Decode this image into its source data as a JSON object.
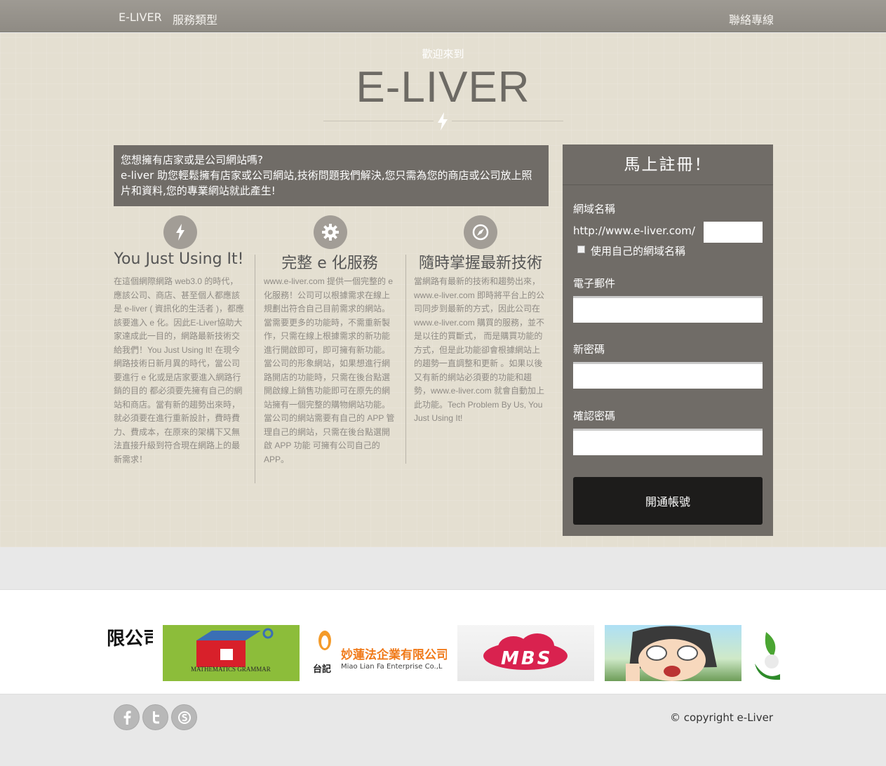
{
  "nav": {
    "brand": "E-LIVER",
    "services": "服務類型",
    "contact": "聯絡專線"
  },
  "hero": {
    "welcome": "歡迎來到",
    "title": "E-LIVER",
    "intro_line1": "您想擁有店家或是公司網站嗎?",
    "intro_line2": "e-liver 助您輕鬆擁有店家或公司網站,技術問題我們解決,您只需為您的商店或公司放上照片和資料,您的專業網站就此產生!"
  },
  "features": [
    {
      "icon": "bolt-icon",
      "title": "You Just Using It!",
      "text": "在這個網際網路 web3.0 的時代，應該公司、商店、甚至個人都應該是 e-liver ( 資訊化的生活者 )，都應該要進入 e 化。因此E-Liver協助大家達成此一目的，網路最新技術交給我們！You Just Using It! 在現今網路技術日新月異的時代，當公司要進行 e 化或是店家要進入網路行銷的目的 都必須要先擁有自己的網站和商店。當有新的趨勢出來時，就必須要在進行重新設計，費時費力、費成本，在原來的架構下又無法直接升級到符合現在網路上的最新需求！"
    },
    {
      "icon": "gear-icon",
      "title": "完整 e 化服務",
      "text": "www.e-liver.com 提供一個完整的 e 化服務！公司可以根據需求在線上規劃出符合自己目前需求的網站。當需要更多的功能時，不需重新製作，只需在線上根據需求的新功能進行開啟即可，即可擁有新功能。當公司的形象網站，如果想進行網路開店的功能時，只需在後台點選開啟線上銷售功能即可在原先的網站擁有一個完整的購物網站功能。當公司的網站需要有自己的 APP 管理自己的網站，只需在後台點選開啟 APP 功能 可擁有公司自己的 APP。"
    },
    {
      "icon": "compass-icon",
      "title": "隨時掌握最新技術",
      "text": "當網路有最新的技術和趨勢出來，www.e-liver.com 即時將平台上的公司同步到最新的方式，因此公司在 www.e-liver.com 購買的服務，並不是以往的買斷式， 而是購買功能的方式，但是此功能卻會根據網站上的趨勢一直調整和更新 。如果以後又有新的網站必須要的功能和趨勢，www.e-liver.com 就會自動加上此功能。Tech Problem By Us, You Just Using It!"
    }
  ],
  "register": {
    "title": "馬上註冊！",
    "domain_label": "網域名稱",
    "domain_prefix": "http://www.e-liver.com/",
    "own_domain_label": "使用自己的網域名稱",
    "email_label": "電子郵件",
    "password_label": "新密碼",
    "confirm_label": "確認密碼",
    "submit": "開通帳號"
  },
  "logos": [
    {
      "name": "company-logo-partial",
      "text": "限公司"
    },
    {
      "name": "mathematics-grammar-logo",
      "text": "MATHEMATICS GRAMMAR"
    },
    {
      "name": "miao-lian-fa-logo",
      "text_cn": "妙蓮法企業有限公司",
      "text_en": "Miao Lian Fa Enterprise Co.,L",
      "brand": "台記"
    },
    {
      "name": "mbs-logo",
      "text": "MBS"
    },
    {
      "name": "anime-character-image"
    },
    {
      "name": "green-leaf-logo"
    }
  ],
  "footer": {
    "copyright": "© copyright e-Liver"
  },
  "colors": {
    "panel": "#706c67",
    "hero_bg": "#e4dfd1",
    "nav_bg": "#96928b",
    "button": "#1d1c1b"
  }
}
